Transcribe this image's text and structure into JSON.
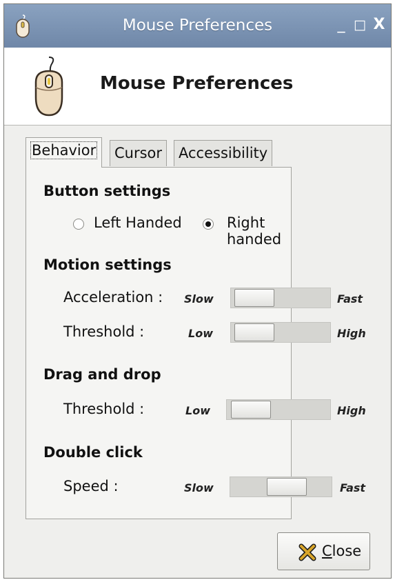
{
  "window": {
    "title": "Mouse Preferences",
    "controls": {
      "minimize": "_",
      "maximize": "□",
      "close": "X"
    }
  },
  "header": {
    "title": "Mouse Preferences",
    "icon": "mouse-icon"
  },
  "tabs": [
    {
      "label": "Behavior",
      "active": true
    },
    {
      "label": "Cursor",
      "active": false
    },
    {
      "label": "Accessibility",
      "active": false
    }
  ],
  "button_settings": {
    "title": "Button settings",
    "left_handed": {
      "label": "Left Handed",
      "checked": false
    },
    "right_handed": {
      "label": "Right handed",
      "checked": true
    }
  },
  "motion_settings": {
    "title": "Motion settings",
    "acceleration": {
      "label": "Acceleration :",
      "min_label": "Slow",
      "max_label": "Fast",
      "value": 0.06
    },
    "threshold": {
      "label": "Threshold :",
      "min_label": "Low",
      "max_label": "High",
      "value": 0.06
    }
  },
  "drag_and_drop": {
    "title": "Drag and drop",
    "threshold": {
      "label": "Threshold :",
      "min_label": "Low",
      "max_label": "High",
      "value": 0.06
    }
  },
  "double_click": {
    "title": "Double click",
    "speed": {
      "label": "Speed :",
      "min_label": "Slow",
      "max_label": "Fast",
      "value": 0.6
    }
  },
  "close_button": {
    "label_first": "C",
    "label_rest": "lose",
    "icon": "close-x-icon"
  },
  "colors": {
    "titlebar": "#7b93b4",
    "panel": "#f5f5f3",
    "window": "#efefed"
  }
}
